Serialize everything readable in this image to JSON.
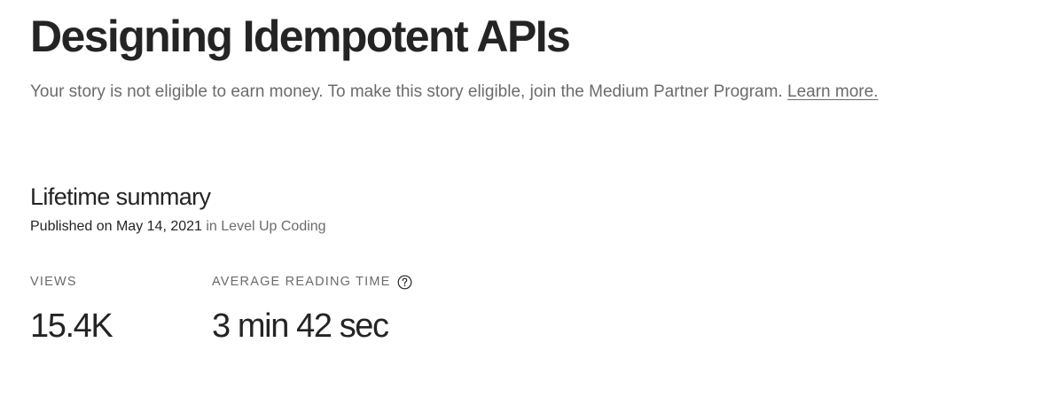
{
  "story": {
    "title": "Designing Idempotent APIs"
  },
  "notice": {
    "text": "Your story is not eligible to earn money. To make this story eligible, join the Medium Partner Program.",
    "link_label": "Learn more."
  },
  "summary": {
    "heading": "Lifetime summary",
    "published_label": "Published on",
    "published_date": "May 14, 2021",
    "in_label": "in",
    "publication": "Level Up Coding"
  },
  "stats": {
    "views_label": "VIEWS",
    "views_value": "15.4K",
    "read_time_label": "AVERAGE READING TIME",
    "read_time_value": "3 min 42 sec",
    "help_icon": "question-circle-icon"
  }
}
